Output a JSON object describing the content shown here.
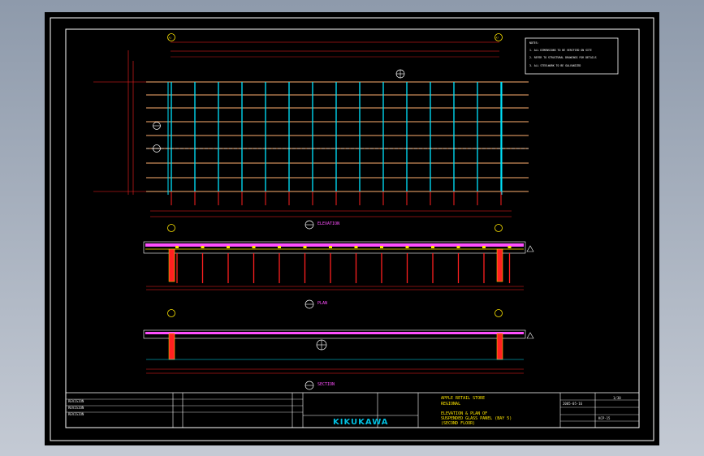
{
  "drawing": {
    "notes_title": "NOTES:",
    "notes": [
      "1.  ALL DIMENSIONS TO BE VERIFIED ON SITE",
      "2.  REFER TO STRUCTURAL DRAWINGS FOR DETAILS",
      "3.  ALL STEELWORK TO BE GALVANIZED"
    ],
    "grid_bubbles": [
      "A1",
      "A7"
    ],
    "view_titles": [
      "ELEVATION",
      "PLAN",
      "SECTION"
    ],
    "client_block": {
      "project_line1": "APPLE RETAIL STORE",
      "project_line2": "REGIONAL",
      "title_line1": "ELEVATION & PLAN OF",
      "title_line2": "SUSPENDED GLASS PANEL (BAY 5)",
      "title_line3": "(SECOND FLOOR)"
    },
    "company": "KIKUKAWA",
    "date_value": "2005-05-16",
    "scale_value": "1/30",
    "drawing_no": "KCP-15",
    "revision_rows": [
      "REVISION",
      "REVISION",
      "REVISION"
    ]
  },
  "colors": {
    "background": "#000000",
    "app_gradient_top": "#8e9aab",
    "cyan": "#00e5ff",
    "red": "#ff2020",
    "orange": "#ffb070",
    "yellow": "#ffe600",
    "magenta": "#ff4fff",
    "white": "#ffffff"
  }
}
